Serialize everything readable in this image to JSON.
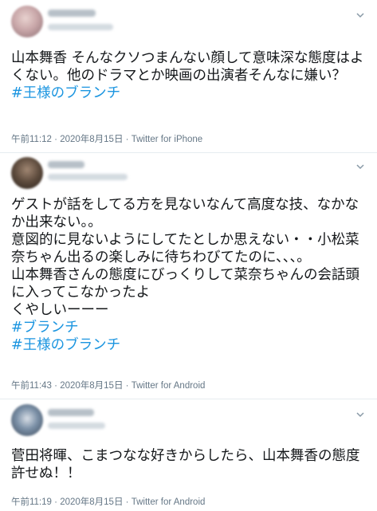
{
  "tweets": [
    {
      "text": "山本舞香 そんなクソつまんない顔して意味深な態度はよくない。他のドラマとか映画の出演者そんなに嫌い？",
      "hashtags": [
        "#王様のブランチ"
      ],
      "time": "午前11:12",
      "date": "2020年8月15日",
      "source": "Twitter for iPhone",
      "avatar_color": "#c9a7a9"
    },
    {
      "text": "ゲストが話をしてる方を見ないなんて高度な技、なかなか出来ない。。\n意図的に見ないようにしてたとしか思えない・・小松菜奈ちゃん出るの楽しみに待ちわびてたのに、、、。\n山本舞香さんの態度にびっくりして菜奈ちゃんの会話頭に入ってこなかったよ\nくやしいーーー",
      "hashtags": [
        "#ブランチ",
        "#王様のブランチ"
      ],
      "time": "午前11:43",
      "date": "2020年8月15日",
      "source": "Twitter for Android",
      "avatar_color": "#5c4a3c"
    },
    {
      "text": "菅田将暉、こまつなな好きからしたら、山本舞香の態度許せぬ！！",
      "hashtags": [],
      "time": "午前11:19",
      "date": "2020年8月15日",
      "source": "Twitter for Android",
      "avatar_color": "#7a8fa6"
    }
  ],
  "colors": {
    "hashtag": "#1b95e0",
    "meta": "#657786",
    "text": "#14171a"
  }
}
